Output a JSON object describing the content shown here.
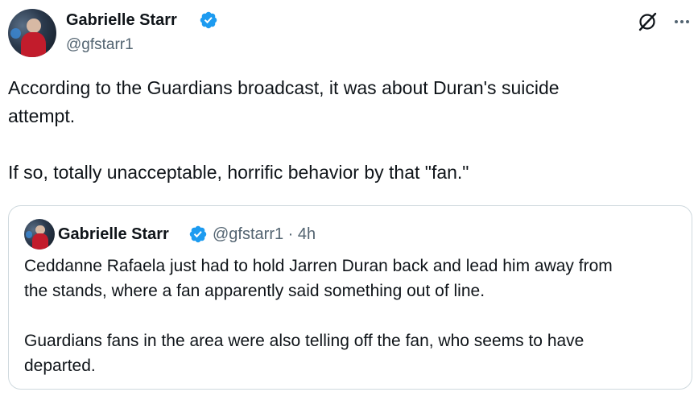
{
  "tweet": {
    "author_name": "Gabrielle Starr",
    "handle": "@gfstarr1",
    "text": "According to the Guardians broadcast, it was about Duran's suicide\nattempt.\n\nIf so, totally unacceptable, horrific behavior by that \"fan.\""
  },
  "quoted_tweet": {
    "author_name": "Gabrielle Starr",
    "meta": "@gfstarr1 · 4h",
    "text": "Ceddanne Rafaela just had to hold Jarren Duran back and lead him away from\nthe stands, where a fan apparently said something out of line.\n\nGuardians fans in the area were also telling off the fan, who seems to have\ndeparted."
  },
  "icons": [
    "verified-badge-icon",
    "grok-icon",
    "more-options-icon"
  ],
  "colors": {
    "verified_blue": "#1d9bf0",
    "text_primary": "#0f1419",
    "text_secondary": "#536471",
    "border": "#cfd9de"
  }
}
